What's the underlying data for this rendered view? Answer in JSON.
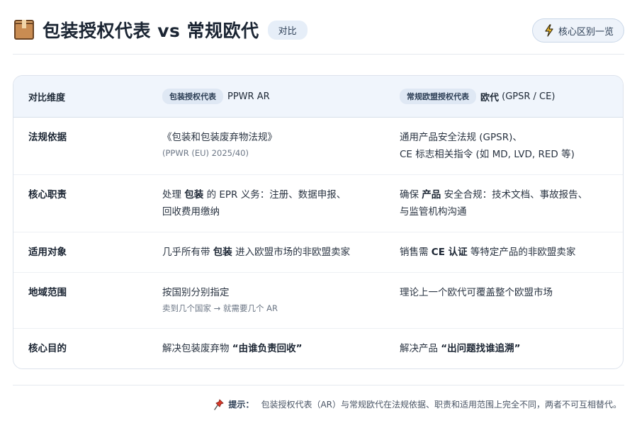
{
  "header": {
    "title": "包装授权代表 vs 常规欧代",
    "badge": "对比",
    "key_button": "核心区别一览"
  },
  "table": {
    "head": {
      "dimension": "对比维度",
      "col_a_pill": "包装授权代表",
      "col_a_name": "PPWR AR",
      "col_b_pill": "常规欧盟授权代表",
      "col_b_name_bold": "欧代",
      "col_b_name_rest": " (GPSR / CE)"
    },
    "rows": [
      {
        "label": "法规依据",
        "a_line1": "《包装和包装废弃物法规》",
        "a_sub": "(PPWR (EU) 2025/40)",
        "b_line1": "通用产品安全法规 (GPSR)、",
        "b_line2": "CE 标志相关指令 (如 MD, LVD, RED 等)"
      },
      {
        "label": "核心职责",
        "a_pre": "处理 ",
        "a_bold": "包装",
        "a_post": " 的 EPR 义务：注册、数据申报、",
        "a_line2": "回收费用缴纳",
        "b_pre": "确保 ",
        "b_bold": "产品",
        "b_post": " 安全合规：技术文档、事故报告、",
        "b_line2": "与监管机构沟通"
      },
      {
        "label": "适用对象",
        "a_pre": "几乎所有带 ",
        "a_bold": "包装",
        "a_post": " 进入欧盟市场的非欧盟卖家",
        "b_pre": "销售需 ",
        "b_bold": "CE 认证",
        "b_post": " 等特定产品的非欧盟卖家"
      },
      {
        "label": "地域范围",
        "a_line1": "按国别分别指定",
        "a_sub": "卖到几个国家 → 就需要几个 AR",
        "b_line1": "理论上一个欧代可覆盖整个欧盟市场"
      },
      {
        "label": "核心目的",
        "a_pre": "解决包装废弃物 ",
        "a_bold": "“由谁负责回收”",
        "b_pre": "解决产品 ",
        "b_bold": "“出问题找谁追溯”"
      }
    ]
  },
  "tip": {
    "label": "提示：",
    "text": "包装授权代表（AR）与常规欧代在法规依据、职责和适用范围上完全不同，两者不可互相替代。"
  },
  "icons": {
    "title": "package-box-icon",
    "button": "lightning-bolt-icon",
    "tip": "pushpin-icon"
  }
}
